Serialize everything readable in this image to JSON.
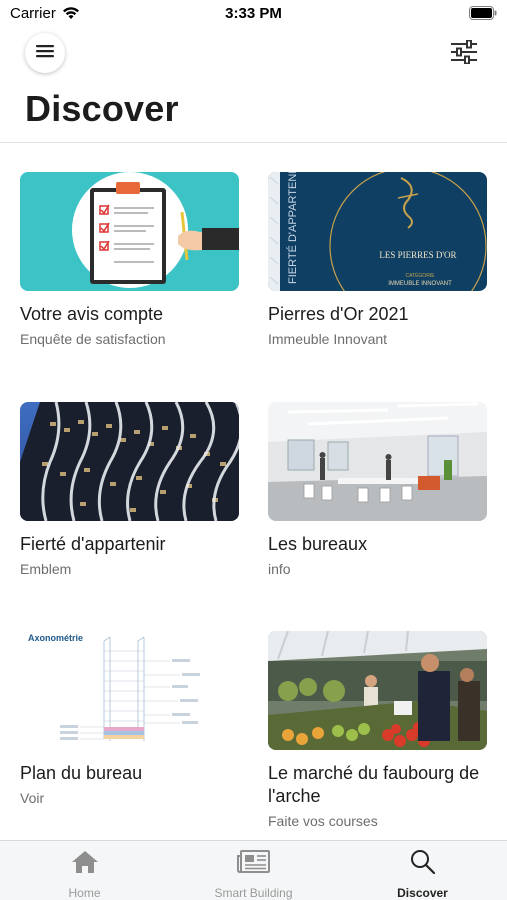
{
  "status_bar": {
    "carrier": "Carrier",
    "time": "3:33 PM"
  },
  "header": {
    "title": "Discover",
    "menu_icon": "hamburger-icon",
    "filter_icon": "sliders-icon"
  },
  "cards": [
    {
      "title": "Votre avis compte",
      "subtitle": "Enquête de satisfaction",
      "image": "survey-clipboard"
    },
    {
      "title": "Pierres d'Or 2021",
      "subtitle": "Immeuble Innovant",
      "image": "pierres-dor-award"
    },
    {
      "title": "Fierté d'appartenir",
      "subtitle": "Emblem",
      "image": "building-facade"
    },
    {
      "title": "Les bureaux",
      "subtitle": "info",
      "image": "office-interior"
    },
    {
      "title": "Plan du bureau",
      "subtitle": "Voir",
      "image": "axonometry-plan"
    },
    {
      "title": "Le marché du faubourg de l'arche",
      "subtitle": "Faite vos courses",
      "image": "market-stall"
    }
  ],
  "thumb_text": {
    "pierres_side": "FIERTÉ D'APPARTENIR",
    "pierres_name": "LES PIERRES D'OR",
    "pierres_category": "CATÉGORIE",
    "pierres_award": "IMMEUBLE INNOVANT",
    "plan_heading": "Axonométrie"
  },
  "tabs": [
    {
      "label": "Home",
      "icon": "home-icon",
      "active": false
    },
    {
      "label": "Smart Building",
      "icon": "newspaper-icon",
      "active": false
    },
    {
      "label": "Discover",
      "icon": "search-icon",
      "active": true
    }
  ],
  "colors": {
    "survey_bg": "#3cc3c6",
    "pierres_bg": "#0f3f63",
    "pierres_gold": "#c8a24a",
    "tab_active": "#222222",
    "tab_inactive": "#9a9a9a"
  }
}
